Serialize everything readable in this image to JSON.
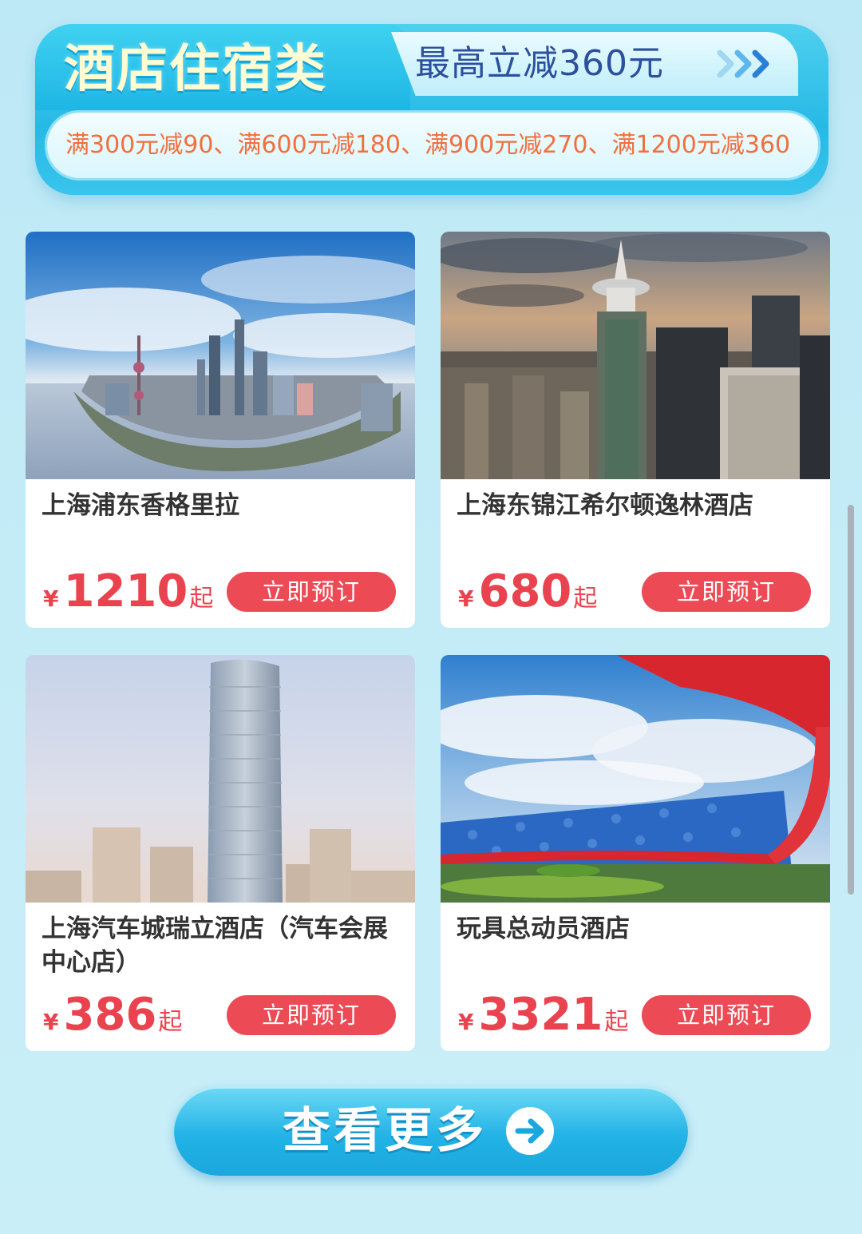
{
  "banner": {
    "title": "酒店住宿类",
    "subtitle": "最高立减360元",
    "rules": "满300元减90、满600元减180、满900元减270、满1200元减360",
    "arrow_icon": "chevrons-right-icon"
  },
  "hotels": [
    {
      "name": "上海浦东香格里拉",
      "currency": "¥",
      "price": "1210",
      "suffix": "起",
      "button": "立即预订"
    },
    {
      "name": "上海东锦江希尔顿逸林酒店",
      "currency": "¥",
      "price": "680",
      "suffix": "起",
      "button": "立即预订"
    },
    {
      "name": "上海汽车城瑞立酒店（汽车会展中心店）",
      "currency": "¥",
      "price": "386",
      "suffix": "起",
      "button": "立即预订"
    },
    {
      "name": "玩具总动员酒店",
      "currency": "¥",
      "price": "3321",
      "suffix": "起",
      "button": "立即预订"
    }
  ],
  "more": {
    "label": "查看更多",
    "icon": "arrow-right-circle-icon"
  },
  "colors": {
    "accent_red": "#ec4a55",
    "banner_blue": "#27b9e6",
    "rules_orange": "#f06f3c"
  }
}
